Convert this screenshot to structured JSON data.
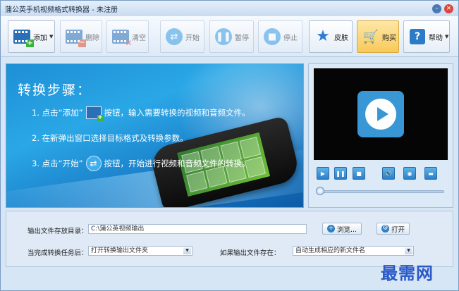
{
  "window": {
    "title": "蒲公英手机视频格式转换器 - 未注册"
  },
  "toolbar": {
    "add": "添加",
    "remove": "删除",
    "clear": "清空",
    "start": "开始",
    "pause": "暂停",
    "stop": "停止",
    "skin": "皮肤",
    "buy": "购买",
    "help": "帮助"
  },
  "banner": {
    "title": "转换步骤：",
    "step1_a": "1. 点击“添加”",
    "step1_b": "按钮，输入需要转换的视频和音频文件。",
    "step2": "2. 在新弹出窗口选择目标格式及转换参数。",
    "step3_a": "3. 点击“开始”",
    "step3_b": "按钮，开始进行视频和音频文件的转换。"
  },
  "settings": {
    "output_dir_label": "输出文件存放目录：",
    "output_dir_value": "C:\\蒲公英视频输出",
    "browse": "浏览...",
    "open": "打开",
    "after_done_label": "当完成转换任务后：",
    "after_done_value": "打开转换输出文件夹",
    "if_exists_label": "如果输出文件存在：",
    "if_exists_value": "自动生成相应的新文件名"
  },
  "player": {
    "progress": 0
  },
  "watermark": "最需网"
}
